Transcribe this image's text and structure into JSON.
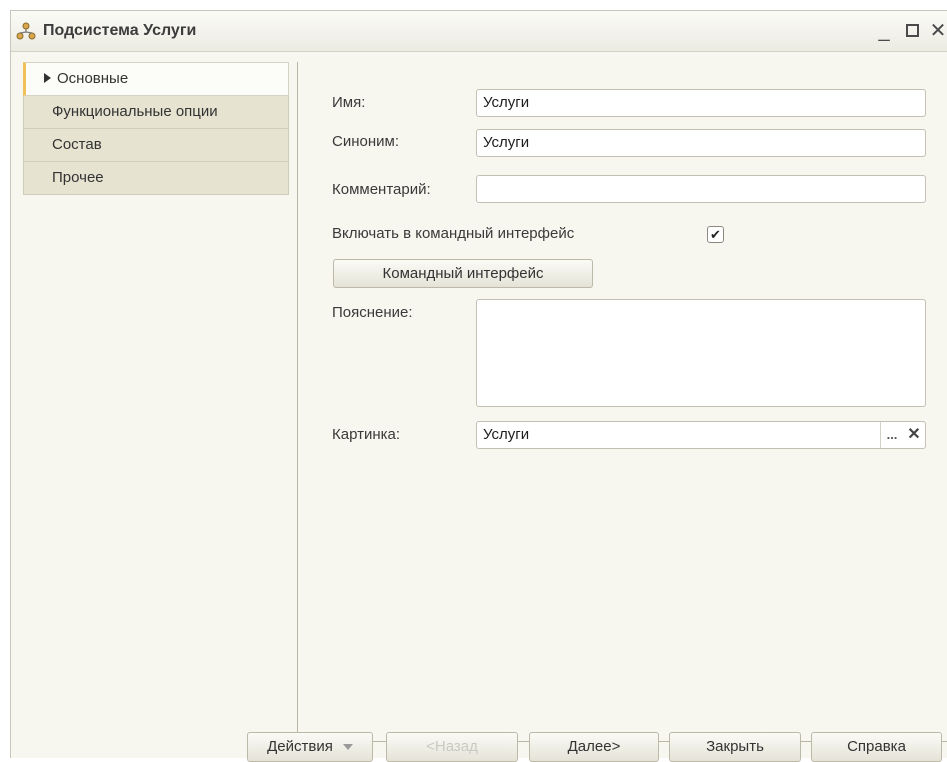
{
  "window": {
    "title": "Подсистема Услуги",
    "minimize": "_",
    "close": "✕"
  },
  "sidebar": {
    "items": [
      {
        "label": "Основные",
        "active": true
      },
      {
        "label": "Функциональные опции",
        "active": false
      },
      {
        "label": "Состав",
        "active": false
      },
      {
        "label": "Прочее",
        "active": false
      }
    ]
  },
  "form": {
    "name_label": "Имя:",
    "name_value": "Услуги",
    "synonym_label": "Синоним:",
    "synonym_value": "Услуги",
    "comment_label": "Комментарий:",
    "comment_value": "",
    "include_label": "Включать в командный интерфейс",
    "include_checked": "✔",
    "command_interface_button": "Командный интерфейс",
    "explanation_label": "Пояснение:",
    "explanation_value": "",
    "picture_label": "Картинка:",
    "picture_value": "Услуги",
    "picture_select": "...",
    "picture_clear": "✕"
  },
  "footer": {
    "actions": "Действия",
    "back": "<Назад",
    "next": "Далее>",
    "close": "Закрыть",
    "help": "Справка"
  }
}
